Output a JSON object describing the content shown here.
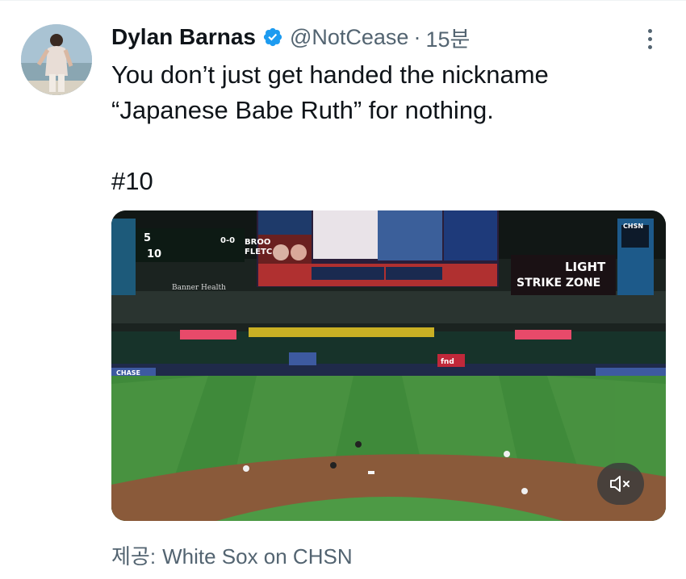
{
  "tweet": {
    "author_name": "Dylan Barnas",
    "handle": "@NotCease",
    "separator": "·",
    "time": "15분",
    "text": "You don’t just get handed the nickname\n“Japanese Babe Ruth” for nothing.\n\n#10"
  },
  "media": {
    "scorebug": {
      "score_top": "5",
      "score_bottom": "10",
      "count": "0-0",
      "batter_1": "BROO",
      "batter_2": "FLETC"
    },
    "signs": {
      "sponsor": "Banner Health",
      "light": "LIGHT",
      "strike_zone": "STRIKE ZONE",
      "chsn": "CHSN",
      "chase": "CHASE",
      "fanduel": "fnd"
    },
    "mute_icon": "speaker-muted-icon"
  },
  "source": {
    "label": "제공:",
    "name": "White Sox on CHSN"
  },
  "colors": {
    "text": "#0f1419",
    "secondary": "#536471",
    "verified": "#1d9bf0"
  }
}
